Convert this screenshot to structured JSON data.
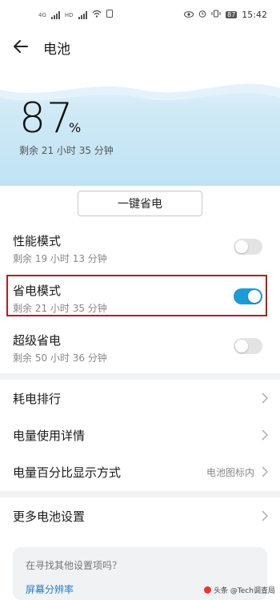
{
  "status_bar": {
    "carrier_tags": [
      "4G",
      "HD"
    ],
    "battery_level": "87",
    "time": "15:42"
  },
  "header": {
    "title": "电池"
  },
  "battery": {
    "percent_value": "87",
    "percent_unit": "%",
    "remaining": "剩余 21 小时 35 分钟"
  },
  "one_key_button": "一键省电",
  "modes": [
    {
      "label": "性能模式",
      "sub": "剩余 19 小时 13 分钟",
      "enabled": false
    },
    {
      "label": "省电模式",
      "sub": "剩余 21 小时 35 分钟",
      "enabled": true
    },
    {
      "label": "超级省电",
      "sub": "剩余 50 小时 36 分钟",
      "enabled": false
    }
  ],
  "menu": [
    {
      "label": "耗电排行",
      "value": ""
    },
    {
      "label": "电量使用详情",
      "value": ""
    },
    {
      "label": "电量百分比显示方式",
      "value": "电池图标内"
    },
    {
      "label": "更多电池设置",
      "value": ""
    }
  ],
  "suggestion": {
    "question": "在寻找其他设置项吗？",
    "link": "屏幕分辨率"
  },
  "watermark": "头条 @Tech调查局",
  "colors": {
    "accent": "#1e9bd7",
    "highlight_border": "#b21f24",
    "hero_bg": "#cfe9f6"
  }
}
